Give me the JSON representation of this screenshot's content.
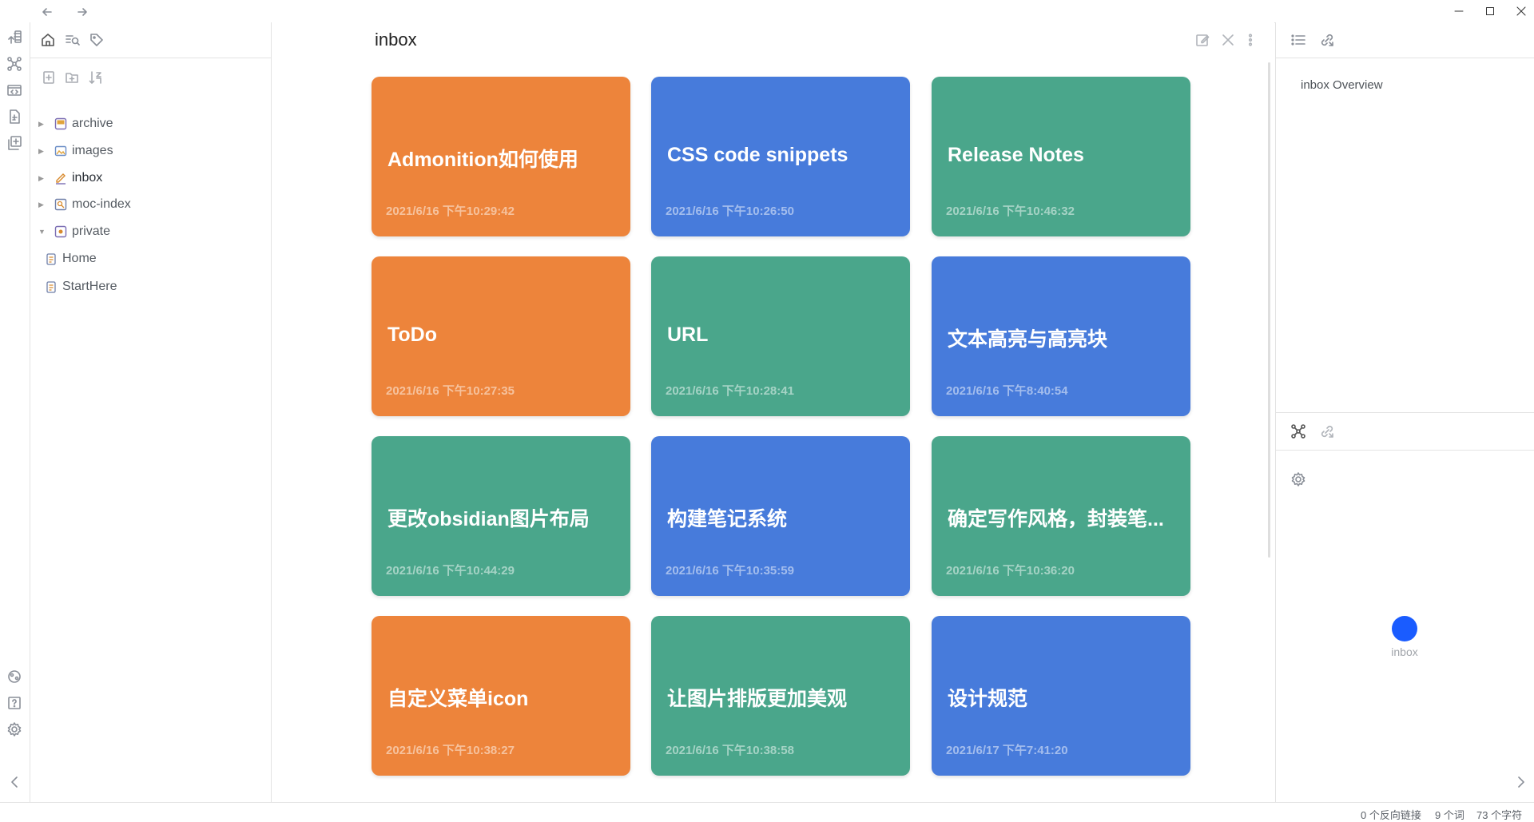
{
  "titlebar": {
    "back_icon": "arrow-left-icon",
    "forward_icon": "arrow-right-icon",
    "controls": [
      "minimize-icon",
      "maximize-icon",
      "close-icon"
    ]
  },
  "ribbon": {
    "top_icons": [
      "switcher-icon",
      "graph-icon",
      "templates-icon",
      "daily-note-icon",
      "new-note-icon"
    ],
    "bottom_icons": [
      "vault-icon",
      "help-icon",
      "settings-icon",
      "collapse-left-icon"
    ]
  },
  "left_sidebar": {
    "tab_icons": [
      "home-icon",
      "search-icon",
      "tag-icon"
    ],
    "actions": [
      "new-note-icon",
      "new-folder-icon",
      "sort-icon"
    ],
    "folders": [
      {
        "label": "archive",
        "expanded": false,
        "color": "#e0a43d"
      },
      {
        "label": "images",
        "expanded": false,
        "color": "#6b8ec6"
      },
      {
        "label": "inbox",
        "expanded": false,
        "color": "#d88a2e"
      },
      {
        "label": "moc-index",
        "expanded": false,
        "color": "#6f7fa8"
      },
      {
        "label": "private",
        "expanded": true,
        "color": "#7a6db3"
      }
    ],
    "files": [
      {
        "label": "Home"
      },
      {
        "label": "StartHere"
      }
    ]
  },
  "main": {
    "title": "inbox",
    "actions": [
      "edit-icon",
      "close-icon",
      "more-options-icon"
    ],
    "cards": [
      {
        "title": "Admonition如何使用",
        "date": "2021/6/16 下午10:29:42",
        "color": "#ed843b"
      },
      {
        "title": "CSS code snippets",
        "date": "2021/6/16 下午10:26:50",
        "color": "#477bdb"
      },
      {
        "title": "Release Notes",
        "date": "2021/6/16 下午10:46:32",
        "color": "#4aa68b"
      },
      {
        "title": "ToDo",
        "date": "2021/6/16 下午10:27:35",
        "color": "#ed843b"
      },
      {
        "title": "URL",
        "date": "2021/6/16 下午10:28:41",
        "color": "#4aa68b"
      },
      {
        "title": "文本高亮与高亮块",
        "date": "2021/6/16 下午8:40:54",
        "color": "#477bdb"
      },
      {
        "title": "更改obsidian图片布局",
        "date": "2021/6/16 下午10:44:29",
        "color": "#4aa68b"
      },
      {
        "title": "构建笔记系统",
        "date": "2021/6/16 下午10:35:59",
        "color": "#477bdb"
      },
      {
        "title": "确定写作风格，封装笔...",
        "date": "2021/6/16 下午10:36:20",
        "color": "#4aa68b"
      },
      {
        "title": "自定义菜单icon",
        "date": "2021/6/16 下午10:38:27",
        "color": "#ed843b"
      },
      {
        "title": "让图片排版更加美观",
        "date": "2021/6/16 下午10:38:58",
        "color": "#4aa68b"
      },
      {
        "title": "设计规范",
        "date": "2021/6/17 下午7:41:20",
        "color": "#477bdb"
      }
    ]
  },
  "right_sidebar": {
    "top_tab_icons": [
      "outline-icon",
      "link-icon"
    ],
    "outline_item": "inbox Overview",
    "bottom_tab_icons": [
      "local-graph-icon",
      "link-icon"
    ],
    "graph_settings_icon": "settings-icon",
    "graph_node": {
      "label": "inbox",
      "color": "#1a5cff"
    },
    "expand_icon": "chevron-right-icon"
  },
  "status_bar": {
    "backlinks": "0 个反向链接",
    "words": "9 个词",
    "characters": "73 个字符"
  }
}
